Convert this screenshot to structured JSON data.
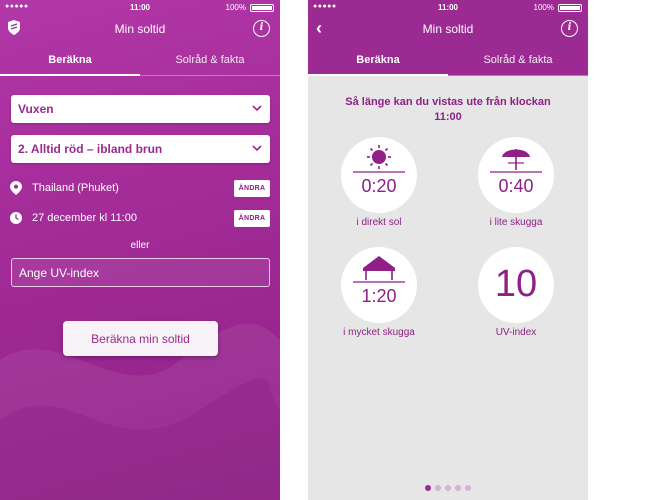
{
  "status_bar": {
    "signal": "●●●●● ",
    "time": "11:00",
    "battery": "100%"
  },
  "left_screen": {
    "nav_title": "Min soltid",
    "tabs": [
      {
        "label": "Beräkna",
        "active": true
      },
      {
        "label": "Solråd & fakta",
        "active": false
      }
    ],
    "age_select": {
      "value": "Vuxen"
    },
    "skin_select": {
      "value": "2. Alltid röd – ibland brun"
    },
    "location": {
      "value": "Thailand (Phuket)",
      "button": "ÄNDRA",
      "icon": "location-pin-icon"
    },
    "datetime": {
      "value": "27 december kl 11:00",
      "button": "ÄNDRA",
      "icon": "clock-icon"
    },
    "or_label": "eller",
    "uv_input": {
      "placeholder": "Ange UV-index",
      "value": ""
    },
    "calculate_button": "Beräkna min soltid"
  },
  "right_screen": {
    "nav_title": "Min soltid",
    "tabs": [
      {
        "label": "Beräkna",
        "active": true
      },
      {
        "label": "Solråd & fakta",
        "active": false
      }
    ],
    "heading_line1": "Så länge kan du vistas ute från klockan",
    "heading_line2": "11:00",
    "results": [
      {
        "value": "0:20",
        "label": "i direkt sol",
        "icon": "sun-icon"
      },
      {
        "value": "0:40",
        "label": "i lite skugga",
        "icon": "parasol-icon"
      },
      {
        "value": "1:20",
        "label": "i mycket skugga",
        "icon": "pavilion-icon"
      },
      {
        "value": "10",
        "label": "UV-index"
      }
    ],
    "pagination": {
      "count": 5,
      "active": 1
    }
  },
  "colors": {
    "primary": "#9c2a93",
    "accent_text": "#8e2086",
    "background": "#e6e6e6"
  }
}
